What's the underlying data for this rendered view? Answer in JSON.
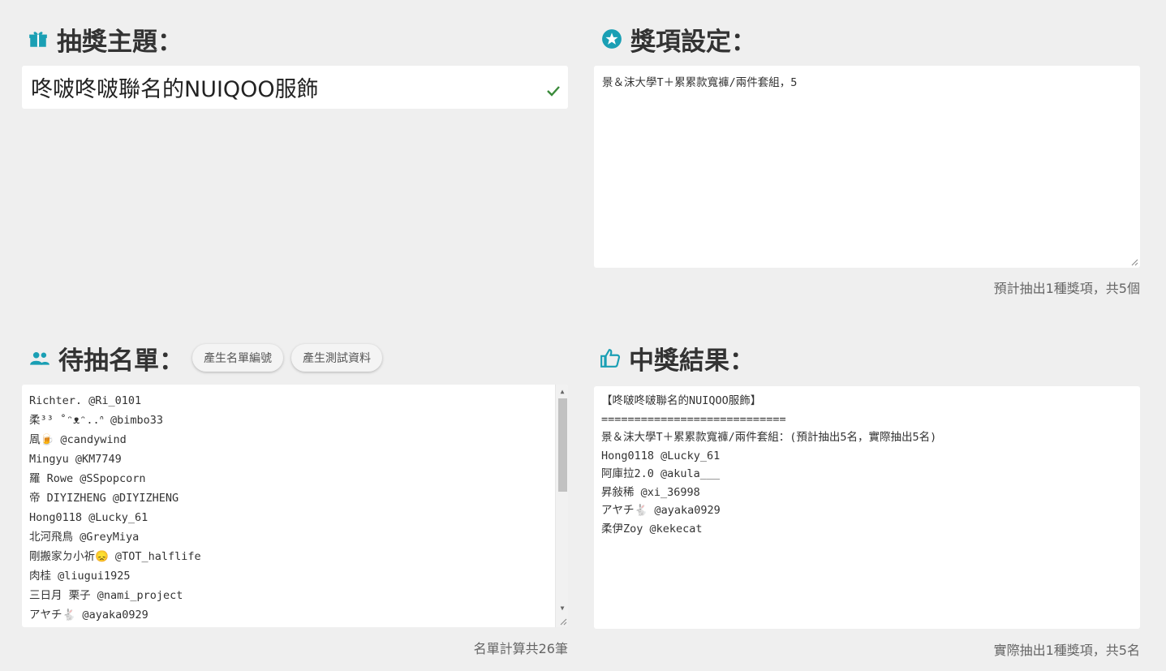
{
  "theme_section": {
    "title": "抽獎主題：",
    "value": "咚啵咚啵聯名的NUIQOO服飾",
    "icon": "gift-icon",
    "check_icon": "check-icon"
  },
  "prize_section": {
    "title": "獎項設定：",
    "icon": "star-icon",
    "lines": [
      "景＆沫大學T＋累累款寬褲/兩件套組，5"
    ],
    "note": "預計抽出1種獎項，共5個"
  },
  "list_section": {
    "title": "待抽名單：",
    "icon": "users-icon",
    "gen_number_button": "產生名單編號",
    "gen_test_button": "產生測試資料",
    "entries": [
      "Richter. @Ri_0101",
      "柔³³ ˚ᵔᴥᵔ..ᐢ @bimbo33",
      "凮🍺 @candywind",
      "Mingyu @KM7749",
      "羅 Rowe @SSpopcorn",
      "帝 DIYIZHENG @DIYIZHENG",
      "Hong0118 @Lucky_61",
      "北河飛鳥 @GreyMiya",
      "剛搬家ㄉ小祈😞 @TOT_halflife",
      "肉桂 @liugui1925",
      "三日月 栗子 @nami_project",
      "アヤチ🐇 @ayaka0929"
    ],
    "note": "名單計算共26筆"
  },
  "result_section": {
    "title": "中獎結果：",
    "icon": "thumbs-up-icon",
    "lines": [
      "【咚啵咚啵聯名的NUIQOO服飾】",
      "============================",
      "景＆沫大學T＋累累款寬褲/兩件套組：(預計抽出5名，實際抽出5名)",
      "Hong0118 @Lucky_61",
      "阿庫拉2.0 @akula___",
      "昇敍稀 @xi_36998",
      "アヤチ🐇 @ayaka0929",
      "柔伊Zoy @kekecat"
    ],
    "note": "實際抽出1種獎項，共5名"
  },
  "colors": {
    "accent": "#1a9fb4",
    "check": "#3a8a3a",
    "background": "#efefef"
  }
}
